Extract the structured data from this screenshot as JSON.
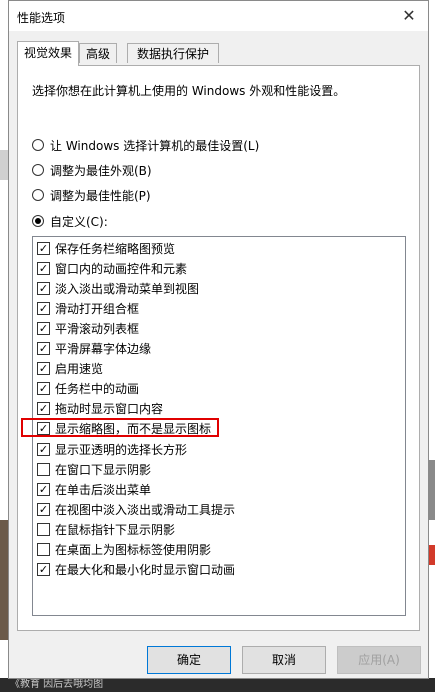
{
  "window": {
    "title": "性能选项"
  },
  "tabs": [
    {
      "label": "视觉效果",
      "active": true
    },
    {
      "label": "高级",
      "active": false
    },
    {
      "label": "数据执行保护",
      "active": false
    }
  ],
  "description": "选择你想在此计算机上使用的 Windows 外观和性能设置。",
  "radios": [
    {
      "label": "让 Windows 选择计算机的最佳设置(L)",
      "checked": false
    },
    {
      "label": "调整为最佳外观(B)",
      "checked": false
    },
    {
      "label": "调整为最佳性能(P)",
      "checked": false
    },
    {
      "label": "自定义(C):",
      "checked": true
    }
  ],
  "effects": [
    {
      "label": "保存任务栏缩略图预览",
      "checked": true
    },
    {
      "label": "窗口内的动画控件和元素",
      "checked": true
    },
    {
      "label": "淡入淡出或滑动菜单到视图",
      "checked": true
    },
    {
      "label": "滑动打开组合框",
      "checked": true
    },
    {
      "label": "平滑滚动列表框",
      "checked": true
    },
    {
      "label": "平滑屏幕字体边缘",
      "checked": true
    },
    {
      "label": "启用速览",
      "checked": true
    },
    {
      "label": "任务栏中的动画",
      "checked": true
    },
    {
      "label": "拖动时显示窗口内容",
      "checked": true
    },
    {
      "label": "显示缩略图，而不是显示图标",
      "checked": true,
      "highlighted": true
    },
    {
      "label": "显示亚透明的选择长方形",
      "checked": true
    },
    {
      "label": "在窗口下显示阴影",
      "checked": false
    },
    {
      "label": "在单击后淡出菜单",
      "checked": true
    },
    {
      "label": "在视图中淡入淡出或滑动工具提示",
      "checked": true
    },
    {
      "label": "在鼠标指针下显示阴影",
      "checked": false
    },
    {
      "label": "在桌面上为图标标签使用阴影",
      "checked": false
    },
    {
      "label": "在最大化和最小化时显示窗口动画",
      "checked": true
    }
  ],
  "buttons": {
    "ok": "确定",
    "cancel": "取消",
    "apply": "应用(A)"
  },
  "background": {
    "bottom_text": "《教育 因后去哦均图"
  },
  "colors": {
    "highlight": "#e00000",
    "dialog_bg": "#f0f0f0",
    "panel_bg": "#ffffff"
  }
}
